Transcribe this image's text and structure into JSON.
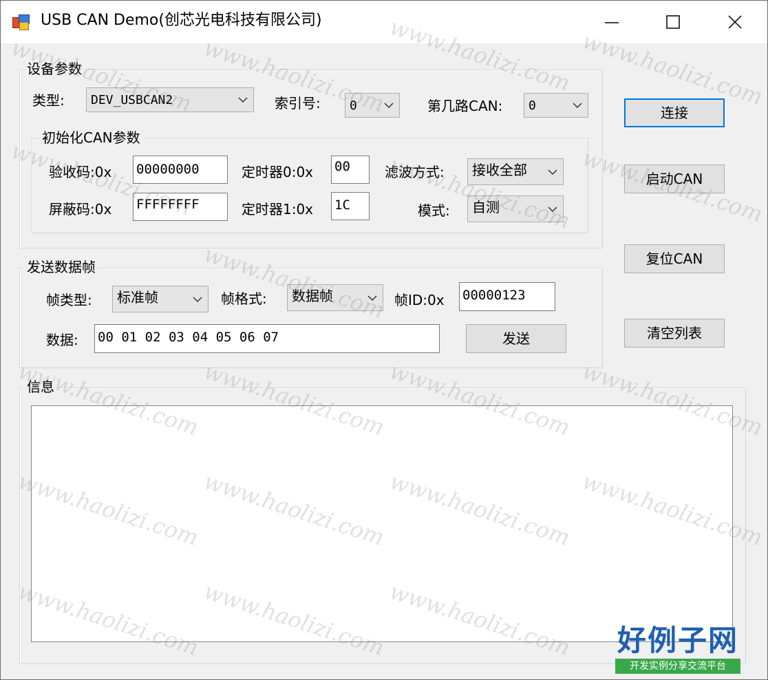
{
  "window": {
    "title": "USB CAN Demo(创芯光电科技有限公司)"
  },
  "device_params": {
    "group_label": "设备参数",
    "type_label": "类型:",
    "type_value": "DEV_USBCAN2",
    "index_label": "索引号:",
    "index_value": "0",
    "channel_label": "第几路CAN:",
    "channel_value": "0"
  },
  "init_params": {
    "group_label": "初始化CAN参数",
    "acc_code_label": "验收码:0x",
    "acc_code_value": "00000000",
    "mask_label": "屏蔽码:0x",
    "mask_value": "FFFFFFFF",
    "timer0_label": "定时器0:0x",
    "timer0_value": "00",
    "timer1_label": "定时器1:0x",
    "timer1_value": "1C",
    "filter_label": "滤波方式:",
    "filter_value": "接收全部",
    "mode_label": "模式:",
    "mode_value": "自测"
  },
  "send_frame": {
    "group_label": "发送数据帧",
    "frame_type_label": "帧类型:",
    "frame_type_value": "标准帧",
    "frame_format_label": "帧格式:",
    "frame_format_value": "数据帧",
    "frame_id_label": "帧ID:0x",
    "frame_id_value": "00000123",
    "data_label": "数据:",
    "data_value": "00 01 02 03 04 05 06 07",
    "send_button": "发送"
  },
  "buttons": {
    "connect": "连接",
    "start_can": "启动CAN",
    "reset_can": "复位CAN",
    "clear_list": "清空列表"
  },
  "info": {
    "group_label": "信息"
  },
  "watermark": {
    "text": "www.haolizi.com",
    "logo_main": "好例子网",
    "logo_sub": "开发实例分享交流平台"
  },
  "colors": {
    "window_bg": "#f0f0f0",
    "focus_border": "#0078d7",
    "logo_blue": "#1f5fb0",
    "logo_green": "#3aa84a"
  }
}
